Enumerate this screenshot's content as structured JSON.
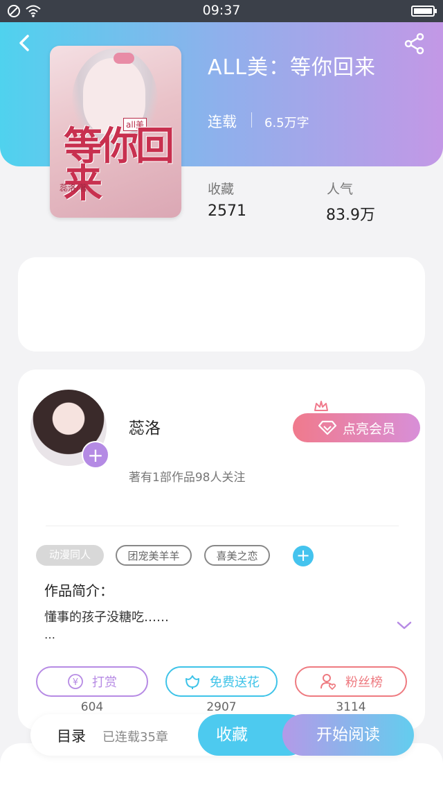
{
  "status_bar": {
    "time": "09:37"
  },
  "book": {
    "title": "ALL美：等你回来",
    "status": "连载",
    "word_count": "6.5万字",
    "cover": {
      "title_art": "等你回来",
      "tag": "all美",
      "author": "蕊洛/著"
    }
  },
  "stats": {
    "favorites_label": "收藏",
    "favorites_value": "2571",
    "popularity_label": "人气",
    "popularity_value": "83.9万"
  },
  "author": {
    "name": "蕊洛",
    "info": "著有1部作品98人关注",
    "vip_button": "点亮会员"
  },
  "tags": [
    "动漫同人",
    "团宠美羊羊",
    "喜美之恋"
  ],
  "intro": {
    "title": "作品简介：",
    "text": "懂事的孩子没糖吃……",
    "more": "…"
  },
  "actions": [
    {
      "label": "打赏",
      "count": "604",
      "color": "#b68ae4"
    },
    {
      "label": "免费送花",
      "count": "2907",
      "color": "#3ec3e8"
    },
    {
      "label": "粉丝榜",
      "count": "3114",
      "color": "#ee7a80"
    }
  ],
  "bottom": {
    "toc_label": "目录",
    "chapter_count": "已连载35章",
    "favorite_button": "收藏",
    "read_button": "开始阅读"
  },
  "colors": {
    "accent_blue": "#4dcaef",
    "accent_purple": "#b68ae4",
    "accent_pink": "#ee7a80"
  }
}
